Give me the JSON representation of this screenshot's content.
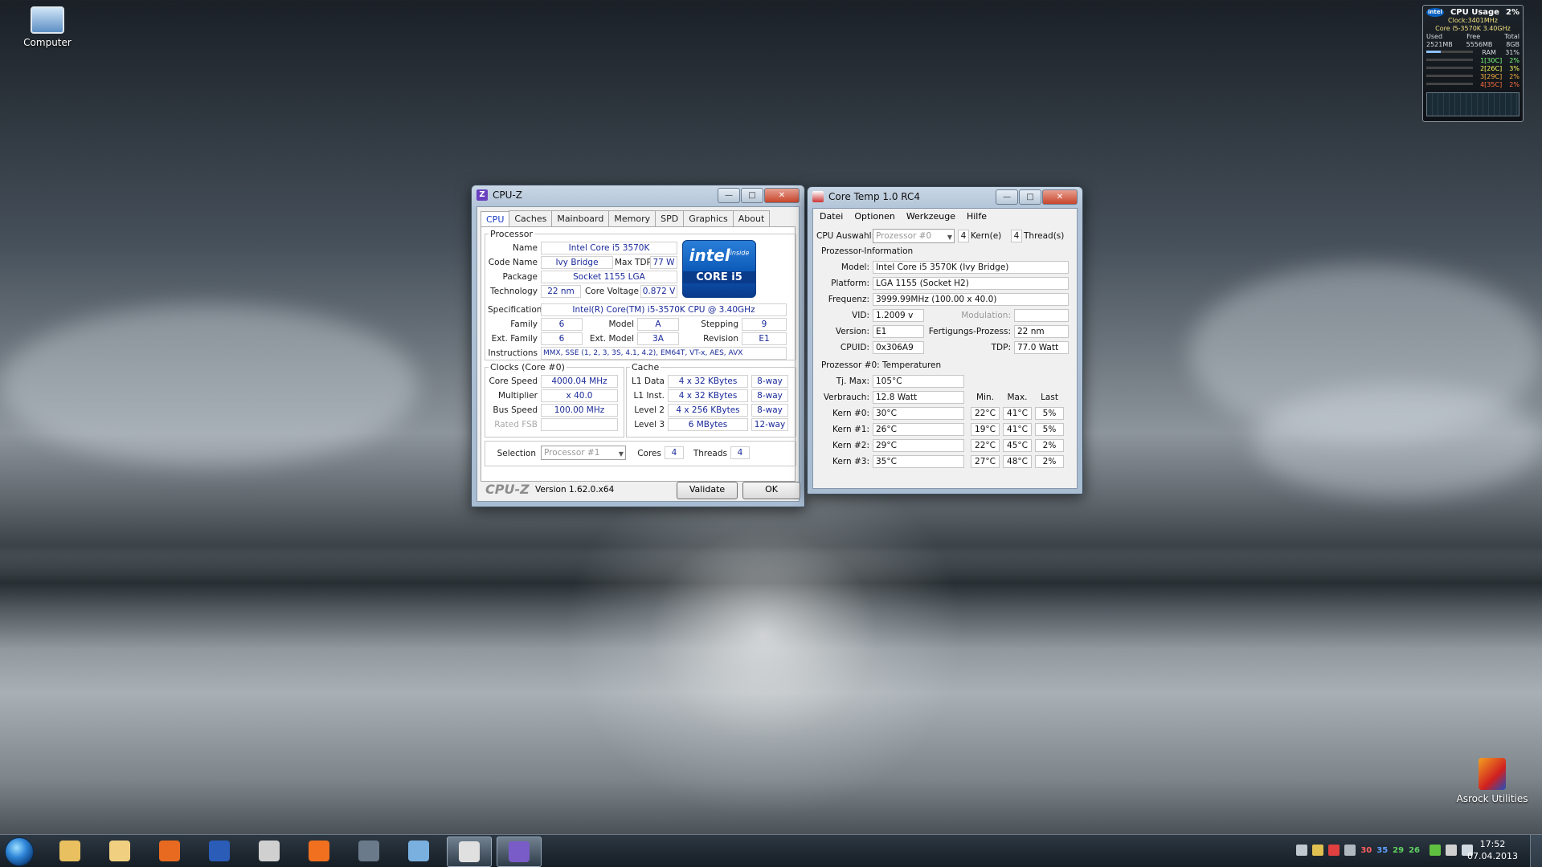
{
  "desktop": {
    "icons": [
      {
        "label": "Computer",
        "icon": "computer-icon"
      },
      {
        "label": "Asrock Utilities",
        "icon": "asrock-icon"
      }
    ]
  },
  "gadget": {
    "title": "CPU Usage",
    "percent": "2%",
    "brand": "intel",
    "clock": "Clock:3401MHz",
    "model": "Core i5-3570K 3.40GHz",
    "mem_headers": [
      "Used",
      "Free",
      "Total"
    ],
    "mem_values": [
      "2521MB",
      "5556MB",
      "8GB"
    ],
    "ram_label": "RAM",
    "ram_percent": "31%",
    "ram_fraction": 0.31,
    "cores": [
      {
        "label": "1[30C]",
        "value": "2%",
        "color": "#80ff80"
      },
      {
        "label": "2[26C]",
        "value": "3%",
        "color": "#ffff60"
      },
      {
        "label": "3[29C]",
        "value": "2%",
        "color": "#ffb040"
      },
      {
        "label": "4[35C]",
        "value": "2%",
        "color": "#ff7040"
      }
    ]
  },
  "cpuz": {
    "title": "CPU-Z",
    "tabs": [
      "CPU",
      "Caches",
      "Mainboard",
      "Memory",
      "SPD",
      "Graphics",
      "About"
    ],
    "active_tab": "CPU",
    "processor_legend": "Processor",
    "name_label": "Name",
    "name": "Intel Core i5 3570K",
    "codename_label": "Code Name",
    "codename": "Ivy Bridge",
    "maxtdp_label": "Max TDP",
    "maxtdp": "77 W",
    "package_label": "Package",
    "package": "Socket 1155 LGA",
    "technology_label": "Technology",
    "technology": "22 nm",
    "corevoltage_label": "Core Voltage",
    "corevoltage": "0.872 V",
    "spec_label": "Specification",
    "spec": "Intel(R) Core(TM) i5-3570K CPU @ 3.40GHz",
    "family_label": "Family",
    "family": "6",
    "model_label": "Model",
    "model": "A",
    "stepping_label": "Stepping",
    "stepping": "9",
    "extfamily_label": "Ext. Family",
    "extfamily": "6",
    "extmodel_label": "Ext. Model",
    "extmodel": "3A",
    "revision_label": "Revision",
    "revision": "E1",
    "instructions_label": "Instructions",
    "instructions": "MMX, SSE (1, 2, 3, 3S, 4.1, 4.2), EM64T, VT-x, AES, AVX",
    "logo_brand": "intel",
    "logo_inside": "inside",
    "logo_core": "CORE i5",
    "clocks_legend": "Clocks (Core #0)",
    "corespeed_label": "Core Speed",
    "corespeed": "4000.04 MHz",
    "multiplier_label": "Multiplier",
    "multiplier": "x 40.0",
    "busspeed_label": "Bus Speed",
    "busspeed": "100.00 MHz",
    "ratedfsb_label": "Rated FSB",
    "ratedfsb": "",
    "cache_legend": "Cache",
    "cache": [
      {
        "label": "L1 Data",
        "size": "4 x 32 KBytes",
        "way": "8-way"
      },
      {
        "label": "L1 Inst.",
        "size": "4 x 32 KBytes",
        "way": "8-way"
      },
      {
        "label": "Level 2",
        "size": "4 x 256 KBytes",
        "way": "8-way"
      },
      {
        "label": "Level 3",
        "size": "6 MBytes",
        "way": "12-way"
      }
    ],
    "selection_label": "Selection",
    "selection": "Processor #1",
    "cores_label": "Cores",
    "cores": "4",
    "threads_label": "Threads",
    "threads": "4",
    "brand_text": "CPU-Z",
    "version": "Version 1.62.0.x64",
    "validate_label": "Validate",
    "ok_label": "OK"
  },
  "coretemp": {
    "title": "Core Temp 1.0 RC4",
    "menu": [
      "Datei",
      "Optionen",
      "Werkzeuge",
      "Hilfe"
    ],
    "cpu_select_label": "CPU Auswahl:",
    "cpu_select": "Prozessor #0",
    "kerne_count": "4",
    "kerne_label": "Kern(e)",
    "threads_count": "4",
    "threads_label": "Thread(s)",
    "info_section": "Prozessor-Information",
    "model_label": "Model:",
    "model": "Intel Core i5 3570K (Ivy Bridge)",
    "platform_label": "Platform:",
    "platform": "LGA 1155 (Socket H2)",
    "freq_label": "Frequenz:",
    "freq": "3999.99MHz (100.00 x 40.0)",
    "vid_label": "VID:",
    "vid": "1.2009 v",
    "modulation_label": "Modulation:",
    "modulation": "",
    "version_label": "Version:",
    "version": "E1",
    "process_label": "Fertigungs-Prozess:",
    "process": "22 nm",
    "cpuid_label": "CPUID:",
    "cpuid": "0x306A9",
    "tdp_label": "TDP:",
    "tdp": "77.0 Watt",
    "temp_section": "Prozessor #0: Temperaturen",
    "tjmax_label": "Tj. Max:",
    "tjmax": "105°C",
    "power_label": "Verbrauch:",
    "power": "12.8 Watt",
    "col_headers": [
      "Min.",
      "Max.",
      "Last"
    ],
    "cores": [
      {
        "label": "Kern #0:",
        "temp": "30°C",
        "min": "22°C",
        "max": "41°C",
        "load": "5%"
      },
      {
        "label": "Kern #1:",
        "temp": "26°C",
        "min": "19°C",
        "max": "41°C",
        "load": "5%"
      },
      {
        "label": "Kern #2:",
        "temp": "29°C",
        "min": "22°C",
        "max": "45°C",
        "load": "2%"
      },
      {
        "label": "Kern #3:",
        "temp": "35°C",
        "min": "27°C",
        "max": "48°C",
        "load": "2%"
      }
    ]
  },
  "taskbar": {
    "apps": [
      {
        "icon": "explorer-icon",
        "color": "#e8c060"
      },
      {
        "icon": "mail-icon",
        "color": "#f0d080"
      },
      {
        "icon": "firefox-icon",
        "color": "#e86a20"
      },
      {
        "icon": "word-icon",
        "color": "#2a5cb8"
      },
      {
        "icon": "skull-app-icon",
        "color": "#d0d0d0"
      },
      {
        "icon": "origin-icon",
        "color": "#f07020"
      },
      {
        "icon": "steam-icon",
        "color": "#6a7a8a"
      },
      {
        "icon": "moon-app-icon",
        "color": "#7ab0e0"
      },
      {
        "icon": "coretemp-icon",
        "color": "#e0e0e0"
      },
      {
        "icon": "cpuz-icon",
        "color": "#7a5cc8"
      }
    ],
    "tray_temps": [
      {
        "value": "30",
        "color": "#ff6060"
      },
      {
        "value": "35",
        "color": "#60a0ff"
      },
      {
        "value": "29",
        "color": "#60d060"
      },
      {
        "value": "26",
        "color": "#60d060"
      }
    ],
    "time": "17:52",
    "date": "07.04.2013"
  }
}
